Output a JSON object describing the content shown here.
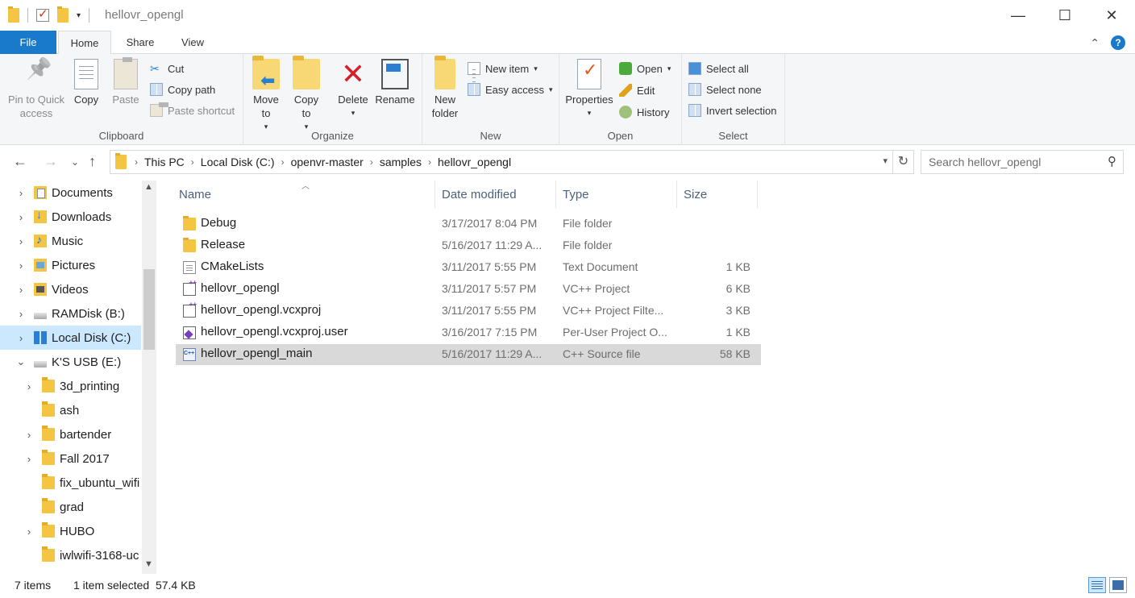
{
  "window": {
    "title": "hellovr_opengl",
    "controls": {
      "minimize": "—",
      "maximize": "☐",
      "close": "✕"
    }
  },
  "ribbon_tabs": {
    "file": "File",
    "home": "Home",
    "share": "Share",
    "view": "View"
  },
  "ribbon": {
    "clipboard": {
      "pin_label": "Pin to Quick access",
      "copy_label": "Copy",
      "paste_label": "Paste",
      "cut_label": "Cut",
      "copy_path_label": "Copy path",
      "paste_shortcut_label": "Paste shortcut",
      "group_label": "Clipboard"
    },
    "organize": {
      "move_to_label": "Move to",
      "copy_to_label": "Copy to",
      "delete_label": "Delete",
      "rename_label": "Rename",
      "group_label": "Organize"
    },
    "new": {
      "new_folder_label": "New folder",
      "new_item_label": "New item",
      "easy_access_label": "Easy access",
      "group_label": "New"
    },
    "open": {
      "properties_label": "Properties",
      "open_label": "Open",
      "edit_label": "Edit",
      "history_label": "History",
      "group_label": "Open"
    },
    "select": {
      "select_all_label": "Select all",
      "select_none_label": "Select none",
      "invert_selection_label": "Invert selection",
      "group_label": "Select"
    }
  },
  "address": {
    "segments": [
      "This PC",
      "Local Disk (C:)",
      "openvr-master",
      "samples",
      "hellovr_opengl"
    ],
    "search_placeholder": "Search hellovr_opengl"
  },
  "nav_tree": [
    {
      "label": "Documents",
      "icon": "documents-icon"
    },
    {
      "label": "Downloads",
      "icon": "downloads-icon"
    },
    {
      "label": "Music",
      "icon": "music-icon"
    },
    {
      "label": "Pictures",
      "icon": "pictures-icon"
    },
    {
      "label": "Videos",
      "icon": "videos-icon"
    },
    {
      "label": "RAMDisk (B:)",
      "icon": "drive-icon"
    },
    {
      "label": "Local Disk (C:)",
      "icon": "windows-drive-icon"
    },
    {
      "label": "K'S USB (E:)",
      "icon": "usb-drive-icon"
    },
    {
      "label": "3d_printing",
      "icon": "folder-icon"
    },
    {
      "label": "ash",
      "icon": "folder-icon"
    },
    {
      "label": "bartender",
      "icon": "folder-icon"
    },
    {
      "label": "Fall 2017",
      "icon": "folder-icon"
    },
    {
      "label": "fix_ubuntu_wifi",
      "icon": "folder-icon"
    },
    {
      "label": "grad",
      "icon": "folder-icon"
    },
    {
      "label": "HUBO",
      "icon": "folder-icon"
    },
    {
      "label": "iwlwifi-3168-uc",
      "icon": "folder-icon"
    }
  ],
  "columns": {
    "name": "Name",
    "date": "Date modified",
    "type": "Type",
    "size": "Size"
  },
  "files": [
    {
      "name": "Debug",
      "date": "3/17/2017 8:04 PM",
      "type": "File folder",
      "size": "",
      "icon": "folder-icon"
    },
    {
      "name": "Release",
      "date": "5/16/2017 11:29 A...",
      "type": "File folder",
      "size": "",
      "icon": "folder-icon"
    },
    {
      "name": "CMakeLists",
      "date": "3/11/2017 5:55 PM",
      "type": "Text Document",
      "size": "1 KB",
      "icon": "text-file-icon"
    },
    {
      "name": "hellovr_opengl",
      "date": "3/11/2017 5:57 PM",
      "type": "VC++ Project",
      "size": "6 KB",
      "icon": "vcxproj-icon"
    },
    {
      "name": "hellovr_opengl.vcxproj",
      "date": "3/11/2017 5:55 PM",
      "type": "VC++ Project Filte...",
      "size": "3 KB",
      "icon": "vcxproj-filters-icon"
    },
    {
      "name": "hellovr_opengl.vcxproj.user",
      "date": "3/16/2017 7:15 PM",
      "type": "Per-User Project O...",
      "size": "1 KB",
      "icon": "vs-user-icon"
    },
    {
      "name": "hellovr_opengl_main",
      "date": "5/16/2017 11:29 A...",
      "type": "C++ Source file",
      "size": "58 KB",
      "icon": "cpp-file-icon"
    }
  ],
  "status": {
    "item_count": "7 items",
    "selection": "1 item selected  57.4 KB"
  }
}
